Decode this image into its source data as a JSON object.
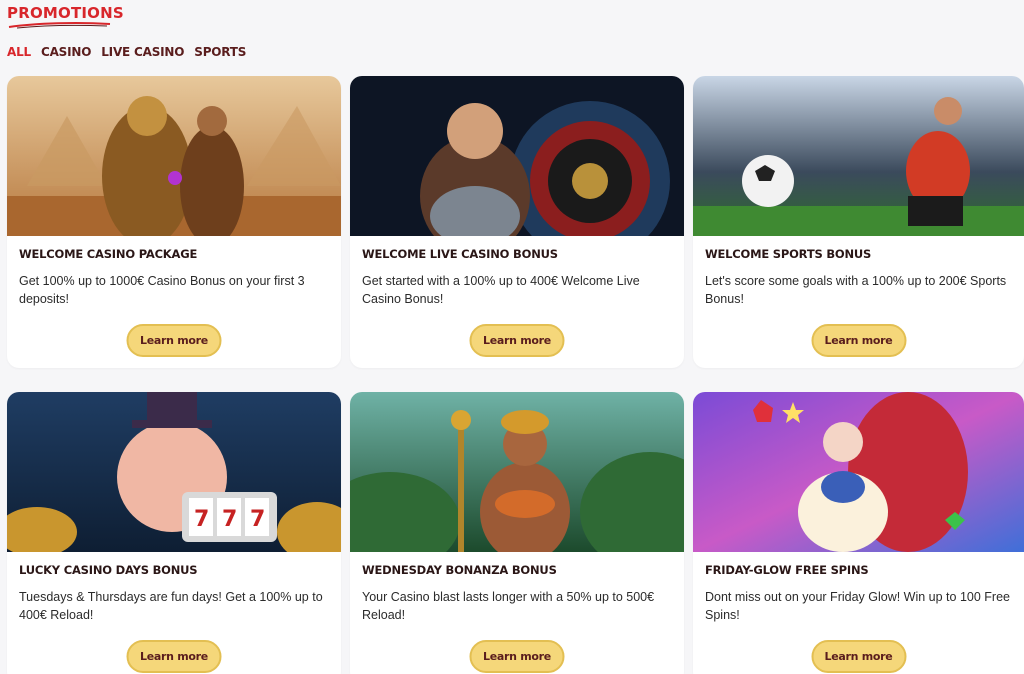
{
  "header": {
    "title": "PROMOTIONS"
  },
  "filters": [
    {
      "label": "ALL",
      "active": true
    },
    {
      "label": "CASINO",
      "active": false
    },
    {
      "label": "LIVE CASINO",
      "active": false
    },
    {
      "label": "SPORTS",
      "active": false
    }
  ],
  "promotions": [
    {
      "title": "WELCOME CASINO PACKAGE",
      "description": "Get 100% up to 1000€ Casino Bonus on your first 3 deposits!",
      "button": "Learn more",
      "image": "egyptian-warriors-image"
    },
    {
      "title": "WELCOME LIVE CASINO BONUS",
      "description": "Get started with a 100% up to 400€ Welcome Live Casino Bonus!",
      "button": "Learn more",
      "image": "roulette-dealer-image"
    },
    {
      "title": "WELCOME SPORTS BONUS",
      "description": "Let's score some goals with a 100% up to 200€ Sports Bonus!",
      "button": "Learn more",
      "image": "football-player-image"
    },
    {
      "title": "LUCKY CASINO DAYS BONUS",
      "description": "Tuesdays & Thursdays are fun days! Get a 100% up to 400€ Reload!",
      "button": "Learn more",
      "image": "pig-slot-image"
    },
    {
      "title": "WEDNESDAY BONANZA BONUS",
      "description": "Your Casino blast lasts longer with a 50% up to 500€ Reload!",
      "button": "Learn more",
      "image": "jungle-queen-image"
    },
    {
      "title": "FRIDAY-GLOW FREE SPINS",
      "description": "Dont miss out on your Friday Glow! Win up to 100 Free Spins!",
      "button": "Learn more",
      "image": "anime-girl-image"
    }
  ],
  "colors": {
    "accent": "#d8262b",
    "button": "#f5d77a",
    "nav": "#5a1d1d"
  }
}
